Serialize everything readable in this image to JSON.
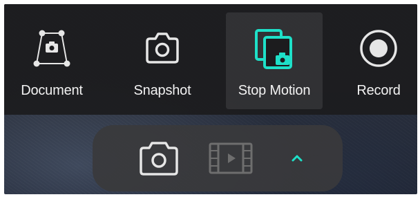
{
  "colors": {
    "accent": "#1ee0c8",
    "text": "#f2f2f2",
    "icon": "#e6e6e6",
    "disabled_icon": "#6e6e6e",
    "toolbar_bg": "#1c1c1e",
    "capsule_bg": "#3a3a3c"
  },
  "modes": [
    {
      "label": "Document",
      "icon": "document-scan-icon",
      "active": false
    },
    {
      "label": "Snapshot",
      "icon": "camera-icon",
      "active": false
    },
    {
      "label": "Stop Motion",
      "icon": "stop-motion-icon",
      "active": true
    },
    {
      "label": "Record",
      "icon": "record-icon",
      "active": false
    }
  ],
  "capture_bar": {
    "photo_icon": "camera-icon",
    "video_icon": "film-icon",
    "expand_icon": "chevron-up-icon"
  }
}
